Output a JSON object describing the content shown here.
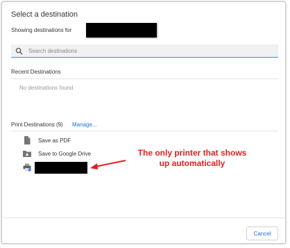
{
  "dialog": {
    "title": "Select a destination",
    "showing_label": "Showing destinations for"
  },
  "search": {
    "placeholder": "Search destinations",
    "icon": "search-icon"
  },
  "recent": {
    "header": "Recent Destinations",
    "empty_text": "No destinations found"
  },
  "print_destinations": {
    "header": "Print Destinations",
    "count": "(9)",
    "manage_label": "Manage...",
    "items": [
      {
        "label": "Save as PDF",
        "icon": "document-icon"
      },
      {
        "label": "Save to Google Drive",
        "icon": "drive-folder-icon"
      },
      {
        "label": "",
        "icon": "printer-icon",
        "redacted": true
      }
    ]
  },
  "annotation": {
    "line1": "The only printer that shows",
    "line2": "up automatically",
    "color": "#e01f1f"
  },
  "footer": {
    "cancel_label": "Cancel"
  },
  "colors": {
    "accent": "#1a73e8",
    "focus_underline": "#4285f4"
  }
}
